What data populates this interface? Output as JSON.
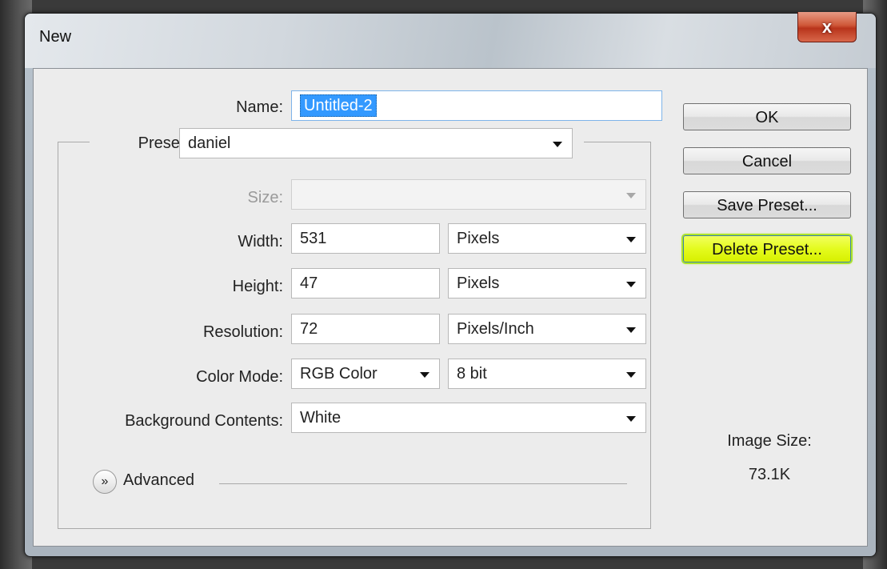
{
  "window": {
    "title": "New",
    "close_glyph": "x"
  },
  "form": {
    "name_label": "Name:",
    "name_value": "Untitled-2",
    "preset_label": "Preset:",
    "preset_value": "daniel",
    "size_label": "Size:",
    "size_value": "",
    "width_label": "Width:",
    "width_value": "531",
    "width_unit": "Pixels",
    "height_label": "Height:",
    "height_value": "47",
    "height_unit": "Pixels",
    "resolution_label": "Resolution:",
    "resolution_value": "72",
    "resolution_unit": "Pixels/Inch",
    "color_mode_label": "Color Mode:",
    "color_mode_value": "RGB Color",
    "bit_depth_value": "8 bit",
    "background_label": "Background Contents:",
    "background_value": "White",
    "advanced_label": "Advanced",
    "advanced_icon": "double-chevron-down-icon"
  },
  "buttons": {
    "ok": "OK",
    "cancel": "Cancel",
    "save_preset": "Save Preset...",
    "delete_preset": "Delete Preset..."
  },
  "info": {
    "image_size_label": "Image Size:",
    "image_size_value": "73.1K"
  },
  "colors": {
    "highlight": "#e4fb1e",
    "selection": "#3399ff",
    "close_button": "#c9472a"
  }
}
